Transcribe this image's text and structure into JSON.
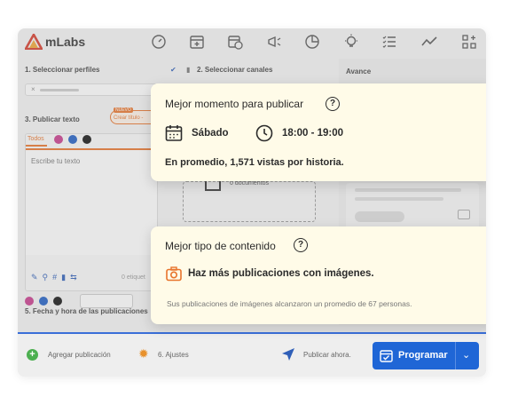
{
  "app": {
    "name": "mLabs"
  },
  "nav_icons": [
    "speedometer-icon",
    "calendar-add-icon",
    "calendar-clock-icon",
    "megaphone-icon",
    "pie-chart-icon",
    "lightbulb-icon",
    "checklist-icon",
    "trend-line-icon",
    "grid-add-icon"
  ],
  "steps": {
    "step1": "1. Seleccionar perfiles",
    "step2": "2. Seleccionar canales",
    "step3": "3. Publicar texto",
    "step5": "5. Fecha y hora de las publicaciones",
    "avance": "Avance"
  },
  "badge": {
    "new": "NUEVO",
    "create_title": "Crear título -"
  },
  "composer": {
    "tab_all": "Todos",
    "placeholder": "Escribe tu texto",
    "labels_count": "0 etiquet"
  },
  "attachments": {
    "docs": "0 documentos",
    "hint": "Crear su publicación"
  },
  "best_time_card": {
    "title": "Mejor momento para publicar",
    "day": "Sábado",
    "time": "18:00 - 19:00",
    "avg": "En promedio, 1,571 vistas por historia."
  },
  "content_card": {
    "title": "Mejor tipo de contenido",
    "tip": "Haz más publicaciones con imágenes.",
    "detail": "Sus publicaciones de imágenes alcanzaron un promedio de 67 personas."
  },
  "bottom": {
    "add_post": "Agregar publicación",
    "settings": "6. Ajustes",
    "publish_now": "Publicar ahora.",
    "program": "Programar"
  },
  "colors": {
    "accent": "#1f66d6",
    "card_bg": "#fffbe8",
    "orange": "#e8742c",
    "brand_red": "#d63a2a"
  }
}
